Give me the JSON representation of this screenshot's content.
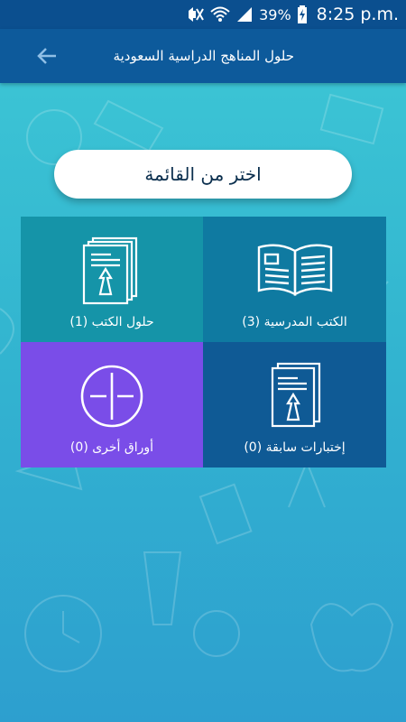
{
  "status_bar": {
    "battery": "39%",
    "time": "8:25 p.m."
  },
  "app_bar": {
    "title": "حلول المناهج الدراسية السعودية",
    "back_icon": "arrow-left-icon"
  },
  "prompt": {
    "label": "اختر من القائمة"
  },
  "tiles": [
    {
      "label": "حلول الكتب (1)",
      "icon": "book-solution-icon",
      "color": "#1594a8"
    },
    {
      "label": "الكتب المدرسية (3)",
      "icon": "open-book-icon",
      "color": "#0f7aa1"
    },
    {
      "label": "أوراق أخرى (0)",
      "icon": "circle-cross-icon",
      "color": "#7a4de8"
    },
    {
      "label": "إختبارات سابقة (0)",
      "icon": "exam-papers-icon",
      "color": "#0f5a95"
    }
  ],
  "colors": {
    "status_bar": "#0b4f8f",
    "app_bar": "#0d5a9b",
    "background_top": "#3ec8d6",
    "background_bottom": "#2d9fcf"
  }
}
